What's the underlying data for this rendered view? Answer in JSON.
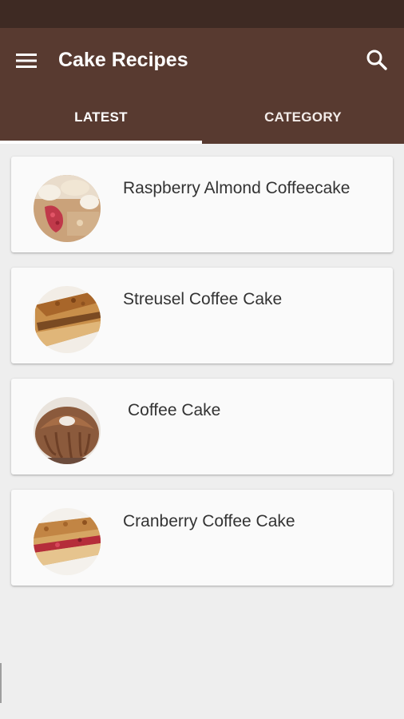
{
  "app_bar": {
    "title": "Cake Recipes",
    "menu_icon": "hamburger-menu-icon",
    "search_icon": "search-icon",
    "colors": {
      "status_bar": "#3e2a23",
      "toolbar": "#583a30",
      "text": "#ffffff"
    }
  },
  "tabs": [
    {
      "label": "LATEST",
      "selected": true
    },
    {
      "label": "CATEGORY",
      "selected": false
    }
  ],
  "recipes": [
    {
      "title": "Raspberry Almond Coffeecake",
      "thumb": "raspberry-almond-coffeecake-photo"
    },
    {
      "title": "Streusel Coffee Cake",
      "thumb": "streusel-coffee-cake-photo"
    },
    {
      "title": "Coffee Cake",
      "thumb": "coffee-cake-photo"
    },
    {
      "title": "Cranberry Coffee Cake",
      "thumb": "cranberry-coffee-cake-photo"
    }
  ]
}
